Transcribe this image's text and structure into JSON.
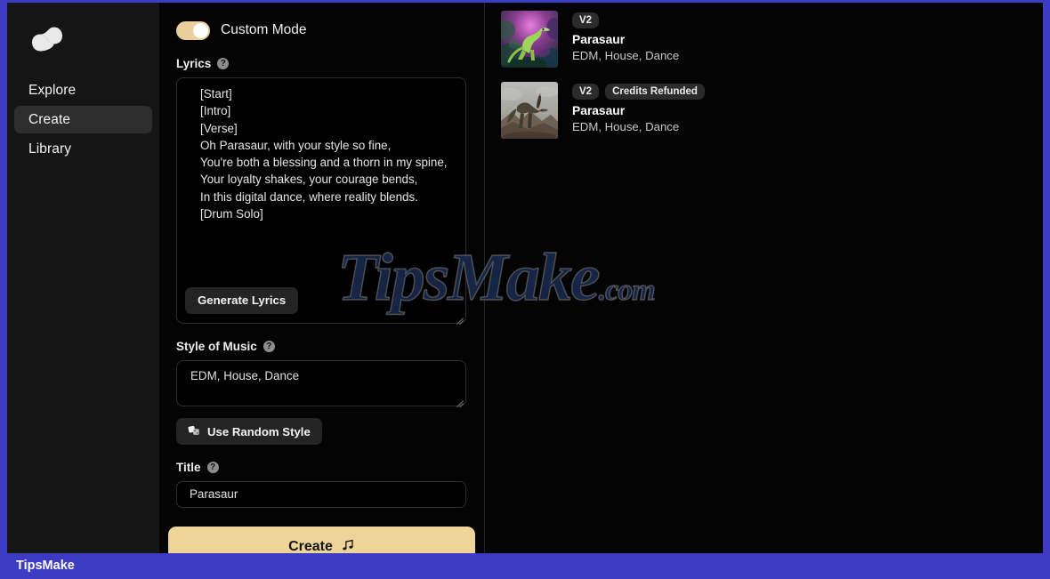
{
  "brand": {
    "logo_icon": "suno-wave-logo-icon",
    "accent_color": "#efd49a",
    "frame_color": "#3b3bc4"
  },
  "sidebar": {
    "items": [
      {
        "label": "Explore",
        "active": false
      },
      {
        "label": "Create",
        "active": true
      },
      {
        "label": "Library",
        "active": false
      }
    ]
  },
  "create_panel": {
    "custom_mode": {
      "label": "Custom Mode",
      "enabled": true
    },
    "lyrics": {
      "label": "Lyrics",
      "help_icon": "question-mark-icon",
      "value": "[Start]\n[Intro]\n[Verse]\nOh Parasaur, with your style so fine,\nYou're both a blessing and a thorn in my spine,\nYour loyalty shakes, your courage bends,\nIn this digital dance, where reality blends.\n[Drum Solo]",
      "generate_button": "Generate Lyrics"
    },
    "style_of_music": {
      "label": "Style of Music",
      "help_icon": "question-mark-icon",
      "value": "EDM, House, Dance",
      "random_button": "Use Random Style",
      "random_button_icon": "dice-shuffle-icon"
    },
    "title": {
      "label": "Title",
      "help_icon": "question-mark-icon",
      "value": "Parasaur"
    },
    "create_button": {
      "label": "Create",
      "icon": "music-note-icon"
    }
  },
  "results": {
    "songs": [
      {
        "badges": [
          "V2"
        ],
        "title": "Parasaur",
        "style": "EDM, House, Dance",
        "thumb_icon": "dinosaur-jungle-artwork"
      },
      {
        "badges": [
          "V2",
          "Credits Refunded"
        ],
        "title": "Parasaur",
        "style": "EDM, House, Dance",
        "thumb_icon": "dinosaur-desert-artwork"
      }
    ]
  },
  "watermark": {
    "text": "TipsMake",
    "suffix": ".com"
  },
  "bottom_bar": {
    "text": "TipsMake"
  }
}
